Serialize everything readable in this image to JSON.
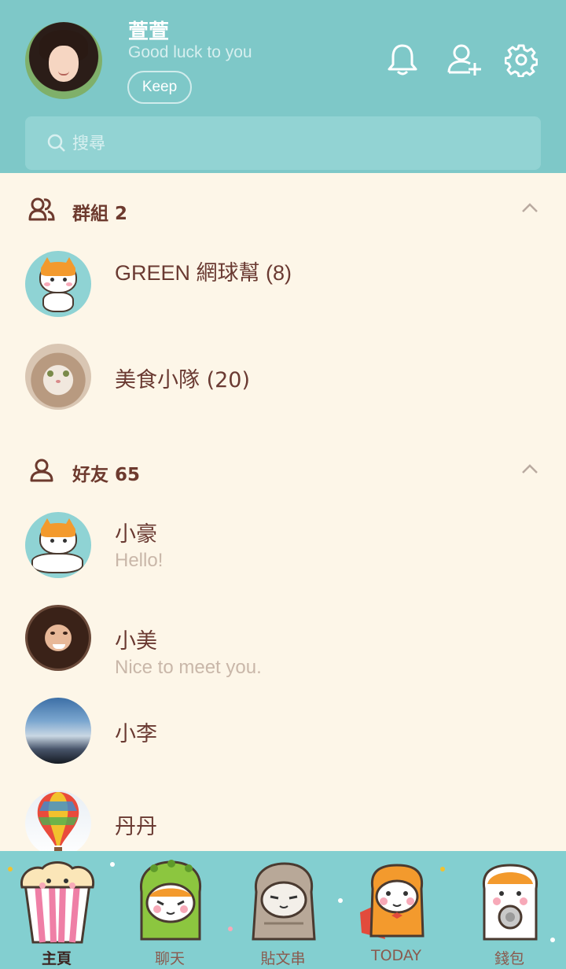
{
  "profile": {
    "name": "萱萱",
    "status": "Good luck to you",
    "keep_label": "Keep"
  },
  "header_icons": [
    "bell-icon",
    "add-friend-icon",
    "settings-icon"
  ],
  "search": {
    "placeholder": "搜尋",
    "value": ""
  },
  "groups": {
    "title": "群組 2",
    "items": [
      {
        "name": "GREEN 網球幫 (8)",
        "avatar": "cat-sticker"
      },
      {
        "name": "美食小隊 (20)",
        "avatar": "cat-photo"
      }
    ]
  },
  "friends": {
    "title": "好友 65",
    "items": [
      {
        "name": "小豪",
        "status": "Hello!",
        "avatar": "cat-sticker-duo"
      },
      {
        "name": "小美",
        "status": "Nice to meet you.",
        "avatar": "woman-photo"
      },
      {
        "name": "小李",
        "status": "",
        "avatar": "sky-photo"
      },
      {
        "name": "丹丹",
        "status": "",
        "avatar": "balloon-photo"
      }
    ]
  },
  "bottom_nav": {
    "active": "主頁",
    "tabs": [
      {
        "label": "主頁",
        "icon": "popcorn-sticker"
      },
      {
        "label": "聊天",
        "icon": "dino-cat-sticker"
      },
      {
        "label": "貼文串",
        "icon": "grey-cat-sticker"
      },
      {
        "label": "TODAY",
        "icon": "cape-cat-sticker"
      },
      {
        "label": "錢包",
        "icon": "coin-cat-sticker"
      }
    ]
  },
  "colors": {
    "header_bg": "#7ec8c8",
    "page_bg": "#fdf6e8",
    "text_primary": "#6a3a32",
    "text_secondary": "#c9b7a9",
    "nav_bg": "#83cfd0"
  }
}
